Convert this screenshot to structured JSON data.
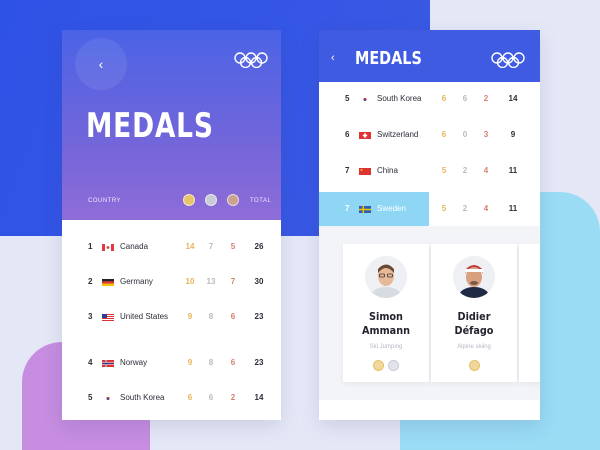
{
  "left": {
    "title": "MEDALS",
    "back_glyph": "‹",
    "col_country": "COUNTRY",
    "col_total": "TOTAL",
    "rows": [
      {
        "rank": "1",
        "country": "Canada",
        "gold": "14",
        "silver": "7",
        "bronze": "5",
        "total": "26"
      },
      {
        "rank": "2",
        "country": "Germany",
        "gold": "10",
        "silver": "13",
        "bronze": "7",
        "total": "30"
      },
      {
        "rank": "3",
        "country": "United States",
        "gold": "9",
        "silver": "8",
        "bronze": "6",
        "total": "23"
      },
      {
        "rank": "4",
        "country": "Norway",
        "gold": "9",
        "silver": "8",
        "bronze": "6",
        "total": "23"
      },
      {
        "rank": "5",
        "country": "South Korea",
        "gold": "6",
        "silver": "6",
        "bronze": "2",
        "total": "14"
      }
    ]
  },
  "right": {
    "title": "MEDALS",
    "back_glyph": "‹",
    "rows": [
      {
        "rank": "5",
        "country": "South Korea",
        "gold": "6",
        "silver": "6",
        "bronze": "2",
        "total": "14"
      },
      {
        "rank": "6",
        "country": "Switzerland",
        "gold": "6",
        "silver": "0",
        "bronze": "3",
        "total": "9"
      },
      {
        "rank": "7",
        "country": "China",
        "gold": "5",
        "silver": "2",
        "bronze": "4",
        "total": "11"
      }
    ],
    "selected": {
      "rank": "7",
      "country": "Sweden",
      "gold": "5",
      "silver": "2",
      "bronze": "4",
      "total": "11"
    },
    "athletes": [
      {
        "first": "Simon",
        "last": "Ammann",
        "sport": "Ski Jumping"
      },
      {
        "first": "Didier",
        "last": "Défago",
        "sport": "Alpine skiing"
      }
    ]
  },
  "colors": {
    "blue": "#3e5be2",
    "gold": "#e8b35a",
    "bronze": "#d48070",
    "highlight": "#8fd6f5"
  },
  "icons": [
    "olympic-rings-icon",
    "back-chevron-icon",
    "gold-medal-icon",
    "silver-medal-icon",
    "bronze-medal-icon"
  ]
}
